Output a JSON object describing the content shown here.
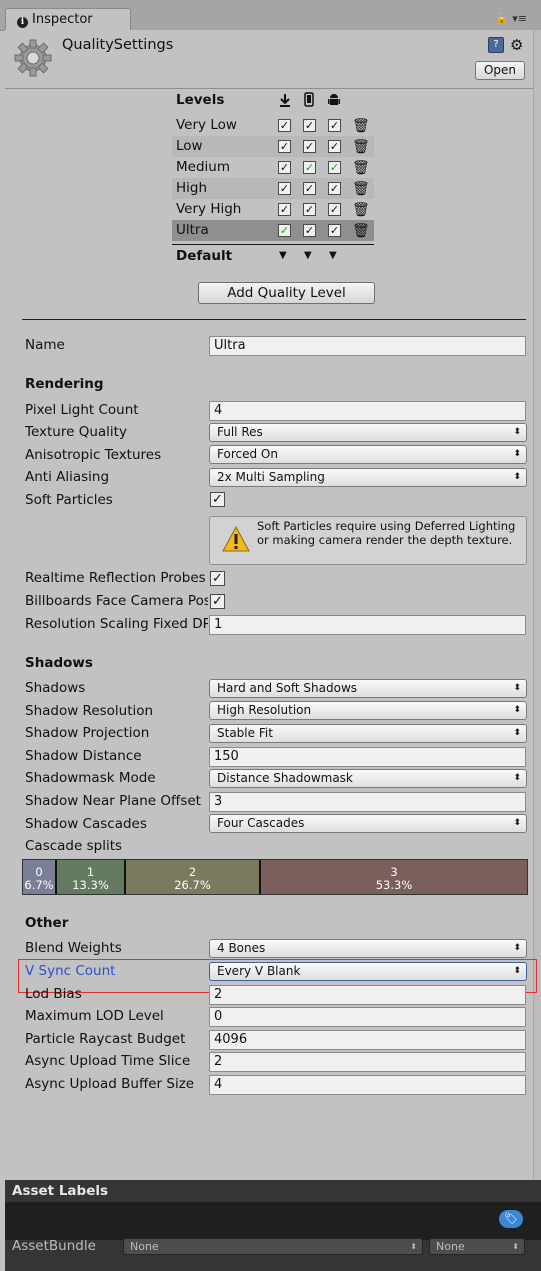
{
  "tab": {
    "title": "Inspector",
    "info_icon": "i",
    "lock_icon": "lock-icon",
    "menu_icon": "menu-icon"
  },
  "header": {
    "title": "QualitySettings",
    "open_label": "Open",
    "help_icon": "?",
    "settings_icon": "⚙"
  },
  "levels": {
    "title": "Levels",
    "platforms": [
      "download-icon",
      "phone-icon",
      "android-icon"
    ],
    "rows": [
      {
        "name": "Very Low",
        "checks": [
          "✓",
          "✓",
          "✓"
        ],
        "green": [
          false,
          false,
          false
        ]
      },
      {
        "name": "Low",
        "checks": [
          "✓",
          "✓",
          "✓"
        ],
        "green": [
          false,
          false,
          false
        ]
      },
      {
        "name": "Medium",
        "checks": [
          "✓",
          "✓",
          "✓"
        ],
        "green": [
          false,
          true,
          true
        ]
      },
      {
        "name": "High",
        "checks": [
          "✓",
          "✓",
          "✓"
        ],
        "green": [
          false,
          false,
          false
        ]
      },
      {
        "name": "Very High",
        "checks": [
          "✓",
          "✓",
          "✓"
        ],
        "green": [
          false,
          false,
          false
        ]
      },
      {
        "name": "Ultra",
        "checks": [
          "✓",
          "✓",
          "✓"
        ],
        "green": [
          true,
          false,
          false
        ]
      }
    ],
    "default_label": "Default",
    "add_button": "Add Quality Level"
  },
  "name_field": {
    "label": "Name",
    "value": "Ultra"
  },
  "rendering": {
    "title": "Rendering",
    "pixel_light_count": {
      "label": "Pixel Light Count",
      "value": "4"
    },
    "texture_quality": {
      "label": "Texture Quality",
      "value": "Full Res"
    },
    "anisotropic": {
      "label": "Anisotropic Textures",
      "value": "Forced On"
    },
    "anti_aliasing": {
      "label": "Anti Aliasing",
      "value": "2x Multi Sampling"
    },
    "soft_particles": {
      "label": "Soft Particles",
      "checked": "✓"
    },
    "help_text": "Soft Particles require using Deferred Lighting or making camera render the depth texture.",
    "realtime_reflection": {
      "label": "Realtime Reflection Probes",
      "checked": "✓"
    },
    "billboards": {
      "label": "Billboards Face Camera Position",
      "checked": "✓"
    },
    "resolution_scaling": {
      "label": "Resolution Scaling Fixed DPI Factor",
      "value": "1"
    }
  },
  "shadows": {
    "title": "Shadows",
    "shadows": {
      "label": "Shadows",
      "value": "Hard and Soft Shadows"
    },
    "resolution": {
      "label": "Shadow Resolution",
      "value": "High Resolution"
    },
    "projection": {
      "label": "Shadow Projection",
      "value": "Stable Fit"
    },
    "distance": {
      "label": "Shadow Distance",
      "value": "150"
    },
    "shadowmask": {
      "label": "Shadowmask Mode",
      "value": "Distance Shadowmask"
    },
    "near_plane": {
      "label": "Shadow Near Plane Offset",
      "value": "3"
    },
    "cascades": {
      "label": "Shadow Cascades",
      "value": "Four Cascades"
    },
    "cascade_splits_label": "Cascade splits",
    "splits": [
      {
        "index": "0",
        "pct": "6.7%",
        "fraction": 0.067
      },
      {
        "index": "1",
        "pct": "13.3%",
        "fraction": 0.133
      },
      {
        "index": "2",
        "pct": "26.7%",
        "fraction": 0.267
      },
      {
        "index": "3",
        "pct": "53.3%",
        "fraction": 0.533
      }
    ]
  },
  "other": {
    "title": "Other",
    "blend_weights": {
      "label": "Blend Weights",
      "value": "4 Bones"
    },
    "vsync": {
      "label": "V Sync Count",
      "value": "Every V Blank"
    },
    "lod_bias": {
      "label": "Lod Bias",
      "value": "2"
    },
    "max_lod": {
      "label": "Maximum LOD Level",
      "value": "0"
    },
    "raycast_budget": {
      "label": "Particle Raycast Budget",
      "value": "4096"
    },
    "upload_time": {
      "label": "Async Upload Time Slice",
      "value": "2"
    },
    "upload_buffer": {
      "label": "Async Upload Buffer Size",
      "value": "4"
    }
  },
  "footer": {
    "title": "Asset Labels",
    "assetbundle_label": "AssetBundle",
    "bundle_value": "None",
    "variant_value": "None"
  },
  "colors": {
    "vsync_label": "#2c50c8",
    "highlight": "#e03030",
    "green_check": "#1a9e1a"
  }
}
